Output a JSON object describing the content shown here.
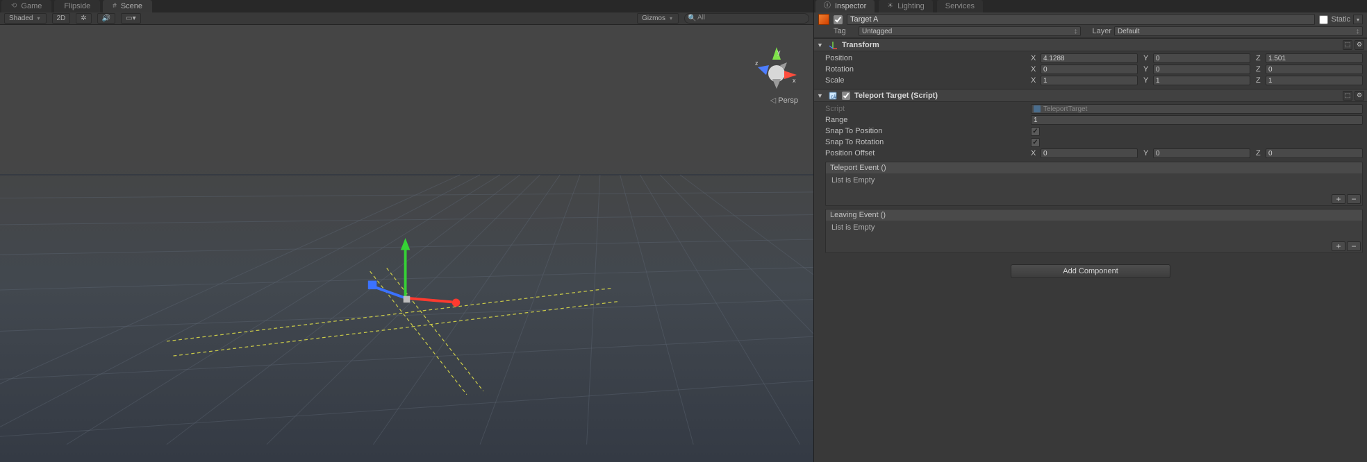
{
  "scene_tabs": {
    "game": "Game",
    "flipside": "Flipside",
    "scene": "Scene"
  },
  "scene_toolbar": {
    "shading": "Shaded",
    "mode_2d": "2D",
    "gizmos": "Gizmos",
    "search_placeholder": "All"
  },
  "viewport": {
    "axis_x": "x",
    "axis_y": "y",
    "axis_z": "z",
    "projection": "Persp"
  },
  "inspector_tabs": {
    "inspector": "Inspector",
    "lighting": "Lighting",
    "services": "Services"
  },
  "gameobject": {
    "enabled": true,
    "name": "Target A",
    "static_label": "Static",
    "static_checked": false,
    "tag_label": "Tag",
    "tag_value": "Untagged",
    "layer_label": "Layer",
    "layer_value": "Default"
  },
  "transform": {
    "title": "Transform",
    "position_label": "Position",
    "position": {
      "x": "4.1288",
      "y": "0",
      "z": "1.501"
    },
    "rotation_label": "Rotation",
    "rotation": {
      "x": "0",
      "y": "0",
      "z": "0"
    },
    "scale_label": "Scale",
    "scale": {
      "x": "1",
      "y": "1",
      "z": "1"
    }
  },
  "teleport": {
    "title": "Teleport Target (Script)",
    "script_label": "Script",
    "script_value": "TeleportTarget",
    "range_label": "Range",
    "range_value": "1",
    "snap_pos_label": "Snap To Position",
    "snap_pos_checked": true,
    "snap_rot_label": "Snap To Rotation",
    "snap_rot_checked": true,
    "offset_label": "Position Offset",
    "offset": {
      "x": "0",
      "y": "0",
      "z": "0"
    },
    "teleport_event_title": "Teleport Event ()",
    "teleport_event_empty": "List is Empty",
    "leaving_event_title": "Leaving Event ()",
    "leaving_event_empty": "List is Empty"
  },
  "add_component_label": "Add Component",
  "xyz_labels": {
    "x": "X",
    "y": "Y",
    "z": "Z"
  }
}
